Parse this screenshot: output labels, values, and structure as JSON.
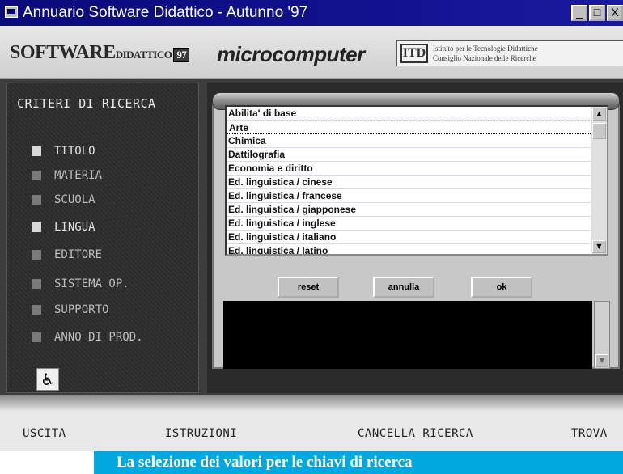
{
  "window": {
    "title": "Annuario Software Didattico - Autunno '97",
    "controls": {
      "minimize": "_",
      "maximize": "□",
      "close": "X"
    }
  },
  "logos": {
    "software_didattico": {
      "main": "SOFTWARE",
      "sub": "DIDATTICO",
      "year": "97"
    },
    "microcomputer": "microcomputer",
    "itd": {
      "mark": "ITD",
      "line1": "Istituto per le Tecnologie Didattiche",
      "line2": "Consiglio Nazionale delle Ricerche"
    }
  },
  "sidebar": {
    "title": "CRITERI DI RICERCA",
    "items": [
      {
        "label": "TITOLO"
      },
      {
        "label": "MATERIA"
      },
      {
        "label": "SCUOLA"
      },
      {
        "label": "LINGUA"
      },
      {
        "label": "EDITORE"
      },
      {
        "label": "SISTEMA OP."
      },
      {
        "label": "SUPPORTO"
      },
      {
        "label": "ANNO DI PROD."
      }
    ],
    "accessibility_icon": "wheelchair-icon"
  },
  "list": {
    "items": [
      "Abilita' di base",
      "Arte",
      "Chimica",
      "Dattilografia",
      "Economia e diritto",
      "Ed. linguistica / cinese",
      "Ed. linguistica / francese",
      "Ed. linguistica / giapponese",
      "Ed. linguistica / inglese",
      "Ed. linguistica / italiano",
      "Ed. linguistica / latino"
    ],
    "selected_index": 1
  },
  "buttons": {
    "reset": "reset",
    "annulla": "annulla",
    "ok": "ok"
  },
  "nav": {
    "uscita": "USCITA",
    "istruzioni": "ISTRUZIONI",
    "cancella": "CANCELLA RICERCA",
    "trova": "TROVA"
  },
  "caption": "La selezione dei valori per le chiavi di ricerca",
  "colors": {
    "title_bar": "#0a0a7a",
    "caption_bg": "#00a8e0",
    "sidebar_bg": "#2b2b2b"
  }
}
